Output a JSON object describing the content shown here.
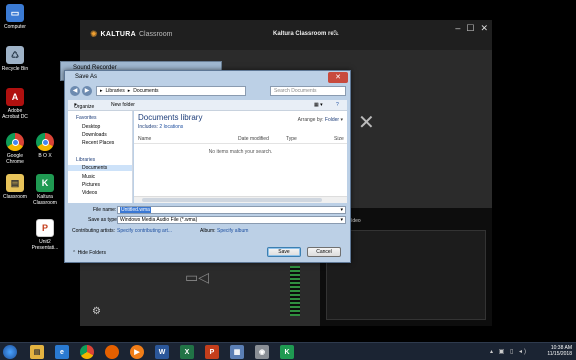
{
  "desktop": {
    "icons": [
      {
        "label": "Computer"
      },
      {
        "label": "Recycle Bin"
      },
      {
        "label": "Adobe\nAcrobat DC"
      },
      {
        "label": "Google\nChrome"
      },
      {
        "label": "B O X"
      },
      {
        "label": "Classroom"
      },
      {
        "label": "Kaltura\nClassroom"
      },
      {
        "label": "Unit2\nPresentati..."
      }
    ]
  },
  "kaltura": {
    "brand": "KALTURA",
    "brand_sub": "Classroom",
    "title": "Kaltura Classroom re...",
    "video_label": "Video",
    "accent": "#2f8f3f"
  },
  "sound_recorder": {
    "title": "Sound Recorder"
  },
  "save_as": {
    "title": "Save As",
    "address": [
      "Libraries",
      "Documents"
    ],
    "search_placeholder": "Search Documents",
    "organize": "Organize",
    "new_folder": "New folder",
    "nav": {
      "favorites": "Favorites",
      "items": [
        "Desktop",
        "Downloads",
        "Recent Places"
      ],
      "libraries": "Libraries",
      "lib_items": [
        "Documents",
        "Music",
        "Pictures",
        "Videos"
      ]
    },
    "library_title": "Documents library",
    "library_sub_prefix": "Includes:",
    "library_sub_link": "2 locations",
    "arrange_by_label": "Arrange by:",
    "arrange_by_value": "Folder",
    "columns": [
      "Name",
      "Date modified",
      "Type",
      "Size"
    ],
    "empty_message": "No items match your search.",
    "file_name_label": "File name:",
    "file_name_value": "Untitled.wma",
    "save_type_label": "Save as type:",
    "save_type_value": "Windows Media Audio File (*.wma)",
    "contrib_label": "Contributing artists:",
    "contrib_value": "Specify contributing art...",
    "album_label": "Album:",
    "album_value": "Specify album",
    "hide_folders": "Hide Folders",
    "save": "Save",
    "cancel": "Cancel"
  },
  "taskbar": {
    "time": "10:38 AM",
    "date": "11/15/2018"
  }
}
